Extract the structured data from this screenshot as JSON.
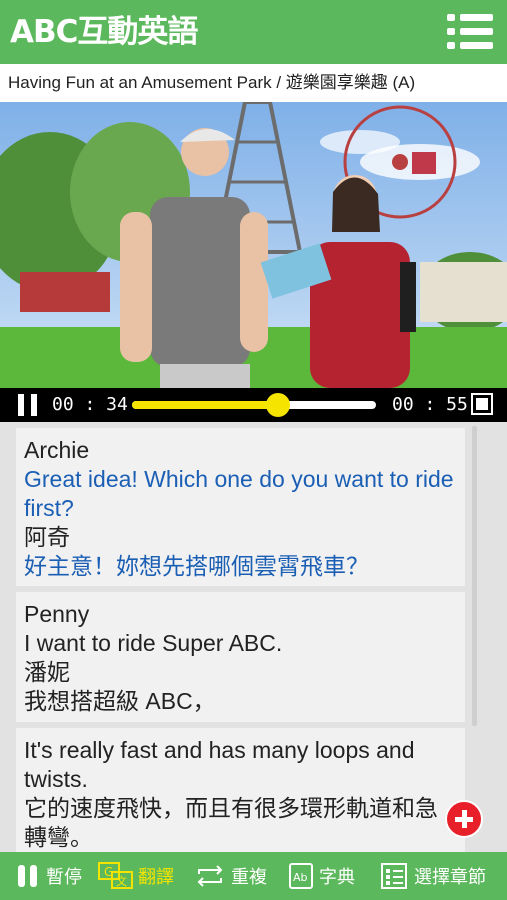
{
  "header": {
    "brand": "ABC互動英語",
    "menu_icon": "hamburger-menu-icon"
  },
  "lesson": {
    "title": "Having Fun at an Amusement Park / 遊樂園享樂趣 (A)"
  },
  "player": {
    "current_time": "00 : 34",
    "total_time": "00 : 55",
    "progress": 0.6,
    "state": "playing"
  },
  "transcript": [
    {
      "speaker_en": "Archie",
      "line_en": "Great idea! Which one do you want to ride first?",
      "speaker_zh": "阿奇",
      "line_zh": "好主意！妳想先搭哪個雲霄飛車？",
      "active": true
    },
    {
      "speaker_en": "Penny",
      "line_en": "I want to ride Super ABC.",
      "speaker_zh": "潘妮",
      "line_zh": "我想搭超級 ABC，",
      "active": false
    },
    {
      "line_en": "It's really fast and has many loops and twists.",
      "line_zh": "它的速度飛快，而且有很多環形軌道和急轉彎。",
      "active": false
    }
  ],
  "toolbar": {
    "pause": "暫停",
    "translate": "翻譯",
    "repeat": "重複",
    "dictionary": "字典",
    "chapters": "選擇章節"
  },
  "colors": {
    "brand_green": "#5cb85c",
    "highlight_blue": "#1b5fb5",
    "active_yellow": "#f5e400",
    "add_red": "#e8202a"
  }
}
